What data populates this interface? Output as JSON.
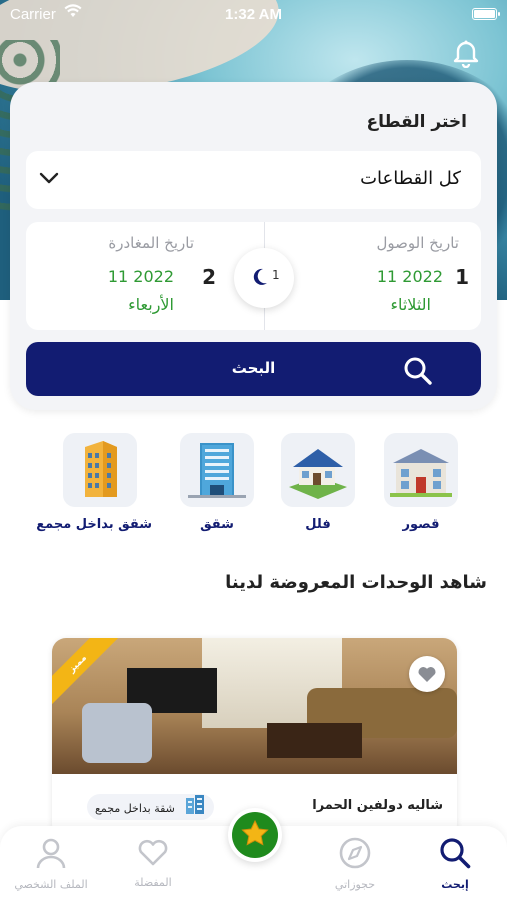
{
  "status": {
    "carrier": "Carrier",
    "time": "1:32 AM"
  },
  "search_card": {
    "title": "اختر القطاع",
    "sector_value": "كل القطاعات",
    "arrival": {
      "label": "تاريخ الوصول",
      "day_num": "1",
      "month_year": "11  2022",
      "weekday": "الثلاثاء"
    },
    "departure": {
      "label": "تاريخ المغادرة",
      "day_num": "2",
      "month_year": "11  2022",
      "weekday": "الأربعاء"
    },
    "nights": "1",
    "search_label": "البحث"
  },
  "categories": [
    {
      "name": "قصور",
      "icon": "palace-icon"
    },
    {
      "name": "فلل",
      "icon": "villa-icon"
    },
    {
      "name": "شقق",
      "icon": "apartment-building-icon"
    },
    {
      "name": "شقق بداخل مجمع",
      "icon": "compound-building-icon"
    }
  ],
  "section_title": "شاهد الوحدات المعروضة لدينا",
  "listing": {
    "name": "شاليه دولفين الحمرا",
    "type": "شقة بداخل مجمع",
    "badge": "مميز"
  },
  "tabs": [
    {
      "label": "إبحث",
      "icon": "search-icon",
      "active": true
    },
    {
      "label": "حجوزاتي",
      "icon": "compass-icon"
    },
    {
      "label": "المفضلة",
      "icon": "heart-icon"
    },
    {
      "label": "الملف الشخصي",
      "icon": "person-icon"
    }
  ],
  "colors": {
    "primary": "#121c72",
    "green": "#2f9a34",
    "badge": "#f3b515",
    "fab": "#1f8a1d"
  }
}
